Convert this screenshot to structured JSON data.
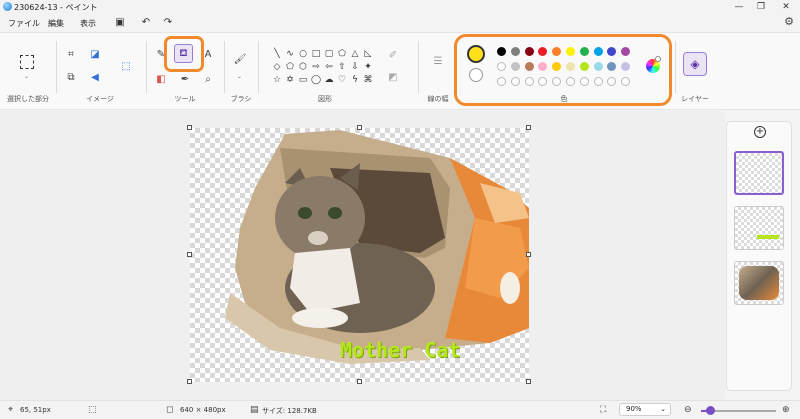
{
  "window": {
    "title": "230624-13 - ペイント",
    "minimize": "—",
    "maximize": "❐",
    "close": "✕"
  },
  "menu": {
    "file": "ファイル",
    "edit": "編集",
    "view": "表示"
  },
  "ribbon": {
    "groups": {
      "selection": "選択した部分",
      "image": "イメージ",
      "tools": "ツール",
      "brushes": "ブラシ",
      "shapes": "図形",
      "line_width": "線の幅",
      "colors": "色",
      "layers": "レイヤー"
    },
    "primary_color": "#ffe11a",
    "palette_row1": [
      "#000000",
      "#7f7f7f",
      "#880015",
      "#ed1c24",
      "#ff7f27",
      "#fff200",
      "#22b14c",
      "#00a2e8",
      "#3f48cc",
      "#a349a4"
    ],
    "palette_row2": [
      "#ffffff",
      "#c3c3c3",
      "#b97a57",
      "#ffaec9",
      "#ffc90e",
      "#efe4b0",
      "#b5e61d",
      "#99d9ea",
      "#7092be",
      "#c8bfe7"
    ]
  },
  "canvas": {
    "overlay_text": "Mother Cat"
  },
  "status": {
    "cursor_position": "65, 51px",
    "canvas_size": "640 × 480px",
    "file_size": "サイズ: 128.7KB",
    "zoom": "90%",
    "zoom_fraction": 0.12
  }
}
